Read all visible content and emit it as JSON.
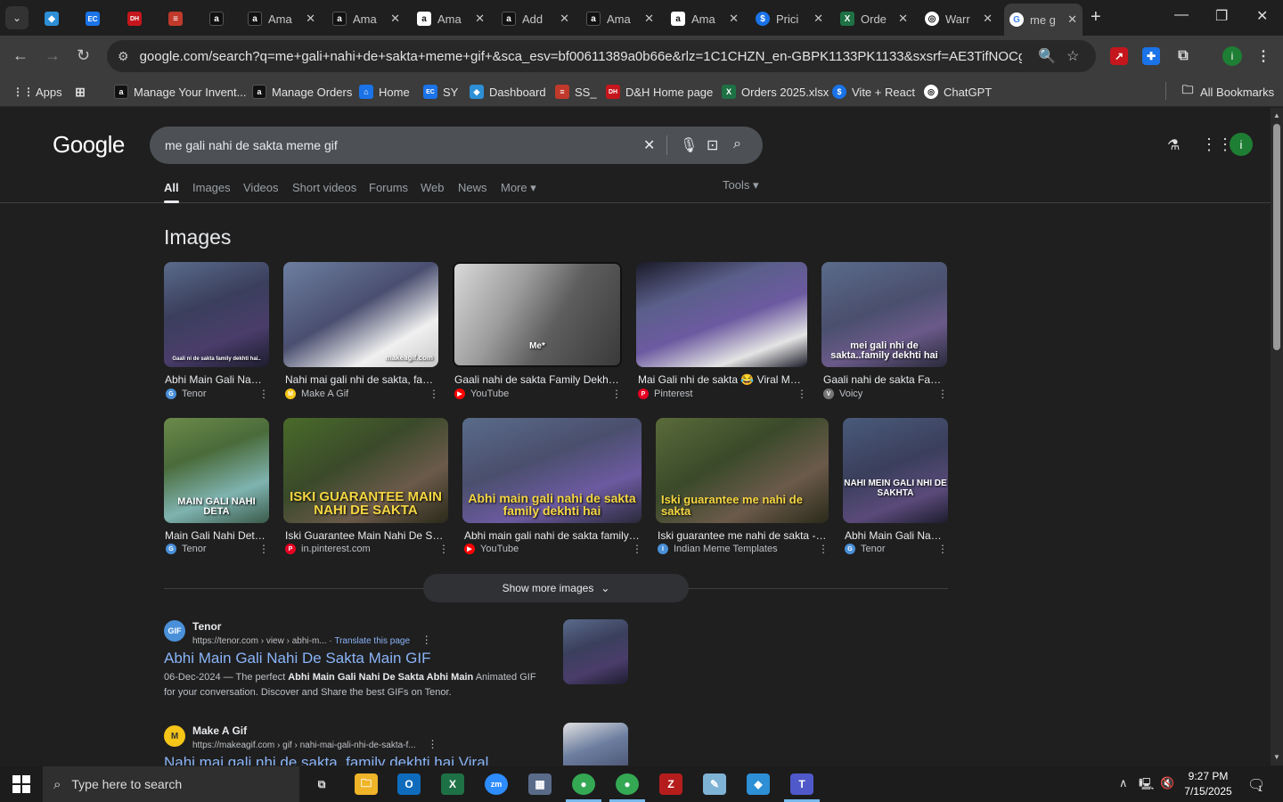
{
  "browser": {
    "tabs": [
      {
        "title": "",
        "icon": "hex-icon",
        "color": "#2d8fd5"
      },
      {
        "title": "",
        "icon": "ec-icon",
        "color": "#1a73e8"
      },
      {
        "title": "",
        "icon": "dh-icon",
        "color": "#c4161c"
      },
      {
        "title": "",
        "icon": "stack-icon",
        "color": "#c0392b"
      },
      {
        "title": "",
        "icon": "amazon-icon",
        "color": "#111111"
      },
      {
        "title": "Ama",
        "icon": "amazon-icon",
        "color": "#111111"
      },
      {
        "title": "Ama",
        "icon": "amazon-icon",
        "color": "#111111"
      },
      {
        "title": "Ama",
        "icon": "amazon-icon",
        "color": "#111111"
      },
      {
        "title": "Add",
        "icon": "amazon-icon",
        "color": "#111111"
      },
      {
        "title": "Ama",
        "icon": "amazon-icon",
        "color": "#111111"
      },
      {
        "title": "Ama",
        "icon": "amazon-icon",
        "color": "#111111"
      },
      {
        "title": "Prici",
        "icon": "dollar-icon",
        "color": "#1a73e8"
      },
      {
        "title": "Orde",
        "icon": "excel-icon",
        "color": "#1e7145"
      },
      {
        "title": "Warr",
        "icon": "openai-icon",
        "color": "#444444"
      },
      {
        "title": "me g",
        "icon": "google-icon",
        "color": "#ffffff"
      }
    ],
    "url": "google.com/search?q=me+gali+nahi+de+sakta+meme+gif+&sca_esv=bf00611389a0b66e&rlz=1C1CHZN_en-GBPK1133PK1133&sxsrf=AE3TifNOCgLwxQpgN...",
    "bookmarks": [
      {
        "label": "Apps",
        "icon": "apps-grid-icon"
      },
      {
        "label": "",
        "icon": "tab-groups-icon"
      },
      {
        "label": "Manage Your Invent...",
        "icon": "amazon-icon"
      },
      {
        "label": "Manage Orders",
        "icon": "amazon-icon"
      },
      {
        "label": "Home",
        "icon": "home-site-icon"
      },
      {
        "label": "SY",
        "icon": "ec-icon"
      },
      {
        "label": "Dashboard",
        "icon": "hex-icon"
      },
      {
        "label": "SS_",
        "icon": "stack-icon"
      },
      {
        "label": "D&H Home page",
        "icon": "dh-icon"
      },
      {
        "label": "Orders 2025.xlsx",
        "icon": "excel-icon"
      },
      {
        "label": "Vite + React",
        "icon": "dollar-icon"
      },
      {
        "label": "ChatGPT",
        "icon": "openai-icon"
      }
    ],
    "all_bookmarks": "All Bookmarks",
    "profile_initial": "i"
  },
  "google": {
    "logo": "Google",
    "query": "me gali nahi de sakta meme gif",
    "nav_tabs": [
      "All",
      "Images",
      "Videos",
      "Short videos",
      "Forums",
      "Web",
      "News",
      "More"
    ],
    "tools": "Tools",
    "account_initial": "i",
    "images_heading": "Images",
    "images": [
      {
        "caption": "Abhi Main Gali Nahi ...",
        "source": "Tenor",
        "overlay": "Gaali ni de sakta family dekhti hai..",
        "src_color": "#4a90d9"
      },
      {
        "caption": "Nahi mai gali nhi de sakta, famil...",
        "source": "Make A Gif",
        "overlay": "makeagif.com",
        "src_color": "#f5c518"
      },
      {
        "caption": "Gaali nahi de sakta Family Dekhti h...",
        "source": "YouTube",
        "overlay": "Me*",
        "src_color": "#ff0000"
      },
      {
        "caption": "Mai Gali nhi de sakta 😂 Viral Mem...",
        "source": "Pinterest",
        "overlay": "",
        "src_color": "#e60023"
      },
      {
        "caption": "Gaali nahi de sakta Famil...",
        "source": "Voicy",
        "overlay": "mei gali nhi de sakta..family dekhti hai",
        "src_color": "#777777"
      },
      {
        "caption": "Main Gali Nahi Deta ...",
        "source": "Tenor",
        "overlay": "MAIN GALI NAHI DETA",
        "src_color": "#4a90d9"
      },
      {
        "caption": "Iski Guarantee Main Nahi De Sakt...",
        "source": "in.pinterest.com",
        "overlay": "ISKI GUARANTEE MAIN NAHI DE SAKTA",
        "src_color": "#e60023"
      },
      {
        "caption": "Abhi main gali nahi de sakta family d...",
        "source": "YouTube",
        "overlay": "Abhi main gali nahi de sakta family dekhti hai",
        "src_color": "#ff0000"
      },
      {
        "caption": "Iski guarantee me nahi de sakta - In...",
        "source": "Indian Meme Templates",
        "overlay": "Iski guarantee me nahi de sakta",
        "src_color": "#4a90d9"
      },
      {
        "caption": "Abhi Main Gali Nahi ...",
        "source": "Tenor",
        "overlay": "NAHI MEIN GALI NHI DE SAKHTA",
        "src_color": "#4a90d9"
      }
    ],
    "show_more": "Show more images",
    "results": [
      {
        "site": "Tenor",
        "url": "https://tenor.com › view › abhi-m...",
        "translate": "Translate this page",
        "title": "Abhi Main Gali Nahi De Sakta Main GIF",
        "date": "06-Dec-2024 —",
        "snippet_pre": "The perfect",
        "snippet_bold": "Abhi Main Gali Nahi De Sakta Abhi Main",
        "snippet_post": "Animated GIF for your conversation. Discover and Share the best GIFs on Tenor.",
        "favicon_text": "GIF",
        "favicon_color": "#4a90d9"
      },
      {
        "site": "Make A Gif",
        "url": "https://makeagif.com › gif › nahi-mai-gali-nhi-de-sakta-f...",
        "title": "Nahi mai gali nhi de sakta, family dekhti hai Viral",
        "favicon_text": "M",
        "favicon_color": "#f5c518"
      }
    ]
  },
  "taskbar": {
    "search_placeholder": "Type here to search",
    "time": "9:27 PM",
    "date": "7/15/2025",
    "notification_count": "1",
    "apps": [
      "task-view-icon",
      "file-explorer-icon",
      "outlook-icon",
      "excel-icon",
      "zoom-icon",
      "calculator-icon",
      "chrome-icon",
      "chrome-profile-icon",
      "filezilla-icon",
      "notepad-icon",
      "hex-app-icon",
      "teams-icon"
    ]
  },
  "colors": {
    "link": "#8ab4f8",
    "background": "#1f1f1f",
    "searchbox": "#4d5156",
    "chrome_toolbar": "#3c3c3c"
  }
}
